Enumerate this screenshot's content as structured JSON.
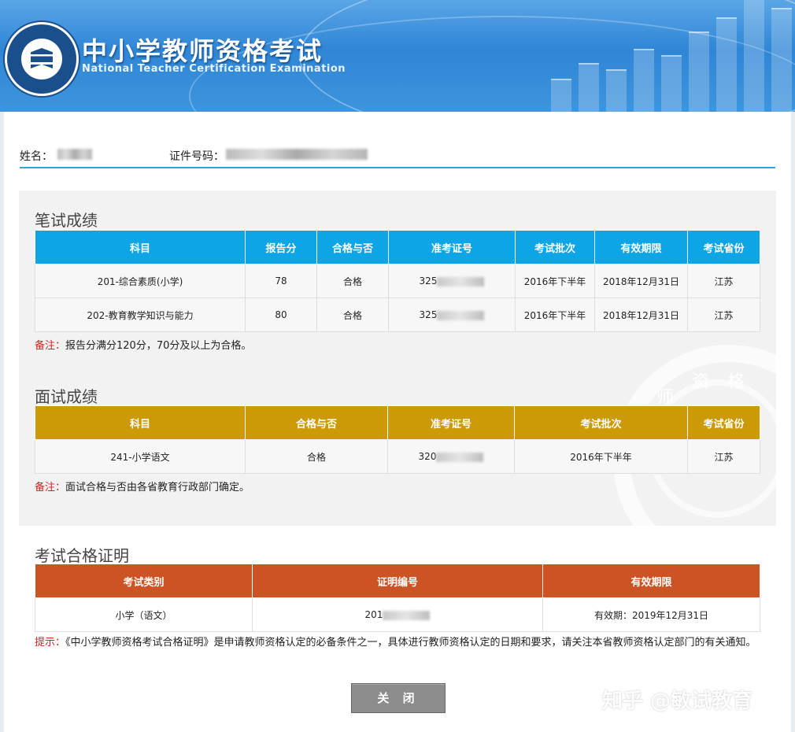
{
  "header": {
    "title_cn": "中小学教师资格考试",
    "title_en": "National Teacher Certification Examination",
    "logo_label": "教师资格考试"
  },
  "identity": {
    "name_label": "姓名：",
    "id_label": "证件号码："
  },
  "written": {
    "title": "笔试成绩",
    "headers": [
      "科目",
      "报告分",
      "合格与否",
      "准考证号",
      "考试批次",
      "有效期限",
      "考试省份"
    ],
    "rows": [
      [
        "201-综合素质(小学)",
        "78",
        "合格",
        "325",
        "2016年下半年",
        "2018年12月31日",
        "江苏"
      ],
      [
        "202-教育教学知识与能力",
        "80",
        "合格",
        "325",
        "2016年下半年",
        "2018年12月31日",
        "江苏"
      ]
    ],
    "note_label": "备注：",
    "note_text": "报告分满分120分，70分及以上为合格。"
  },
  "interview": {
    "title": "面试成绩",
    "headers": [
      "科目",
      "合格与否",
      "准考证号",
      "考试批次",
      "考试省份"
    ],
    "rows": [
      [
        "241-小学语文",
        "合格",
        "320",
        "2016年下半年",
        "江苏"
      ]
    ],
    "note_label": "备注：",
    "note_text": "面试合格与否由各省教育行政部门确定。"
  },
  "certificate": {
    "title": "考试合格证明",
    "headers": [
      "考试类别",
      "证明编号",
      "有效期限"
    ],
    "rows": [
      [
        "小学（语文）",
        "201",
        "有效期：2019年12月31日"
      ]
    ],
    "note_label": "提示：",
    "note_text": "《中小学教师资格考试合格证明》是申请教师资格认定的必备条件之一，具体进行教师资格认定的日期和要求，请关注本省教师资格认定部门的有关通知。"
  },
  "close_button": "关 闭",
  "watermark": {
    "zhihu": "知乎 @敏试教育",
    "seal_chars": [
      "师",
      "资",
      "格"
    ]
  },
  "colors": {
    "written_header": "#0ea5e6",
    "interview_header": "#cc9a06",
    "certificate_header": "#cc5424",
    "note_label": "#d42020"
  }
}
